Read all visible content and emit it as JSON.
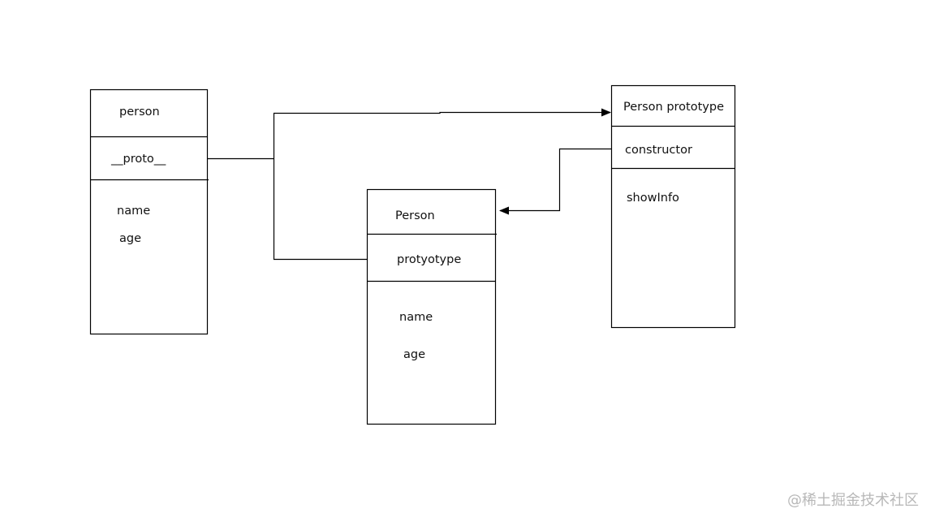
{
  "instance_box": {
    "title": "person",
    "proto_field": "__proto__",
    "fields": [
      "name",
      "age"
    ]
  },
  "constructor_box": {
    "title": "Person",
    "prototype_field": "protyotype",
    "fields": [
      "name",
      "age"
    ]
  },
  "prototype_box": {
    "title": "Person prototype",
    "constructor_field": "constructor",
    "methods": [
      "showInfo"
    ]
  },
  "watermark": "@稀土掘金技术社区"
}
